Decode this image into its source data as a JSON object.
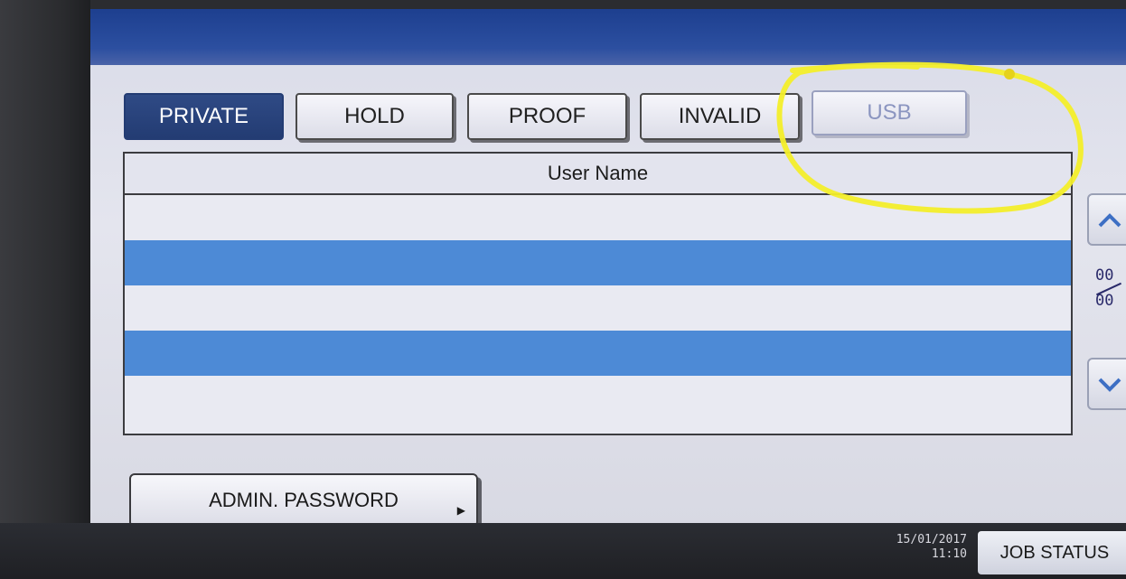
{
  "tabs": [
    {
      "label": "PRIVATE",
      "state": "active"
    },
    {
      "label": "HOLD",
      "state": "normal"
    },
    {
      "label": "PROOF",
      "state": "normal"
    },
    {
      "label": "INVALID",
      "state": "normal"
    },
    {
      "label": "USB",
      "state": "disabled"
    }
  ],
  "table": {
    "header": "User Name",
    "rows": [
      "",
      "",
      "",
      "",
      ""
    ]
  },
  "scroll": {
    "up_icon": "chevron-up-icon",
    "down_icon": "chevron-down-icon",
    "current_page": "00",
    "total_pages": "00"
  },
  "admin_button": {
    "label": "ADMIN. PASSWORD",
    "icon": "triangle-right-icon"
  },
  "status_bar": {
    "date": "15/01/2017",
    "time": "11:10",
    "job_status_label": "JOB STATUS"
  },
  "colors": {
    "screen_top": "#1d3f8f",
    "tab_active": "#233c73",
    "row_highlight": "#4d8ad6",
    "annotation": "#f3ee2a"
  }
}
